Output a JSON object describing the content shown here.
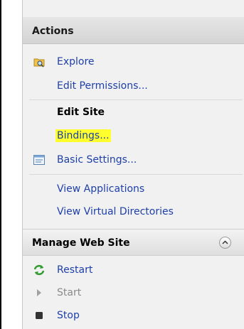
{
  "actions_panel": {
    "title": "Actions",
    "items": [
      {
        "label": "Explore",
        "icon": "folder-explore-icon"
      },
      {
        "label": "Edit Permissions..."
      }
    ],
    "edit_site": {
      "title": "Edit Site",
      "bindings": "Bindings...",
      "basic_settings": {
        "label": "Basic Settings...",
        "icon": "settings-window-icon"
      }
    },
    "view_items": [
      {
        "label": "View Applications"
      },
      {
        "label": "View Virtual Directories"
      }
    ],
    "manage": {
      "title": "Manage Web Site",
      "restart": {
        "label": "Restart",
        "icon": "restart-icon"
      },
      "start": {
        "label": "Start",
        "icon": "play-icon"
      },
      "stop": {
        "label": "Stop",
        "icon": "stop-icon"
      }
    }
  },
  "colors": {
    "link": "#1e3fa8",
    "highlight": "#ffff2e",
    "header_bg": "#d8d8d8",
    "panel_bg": "#f1f1f1"
  }
}
